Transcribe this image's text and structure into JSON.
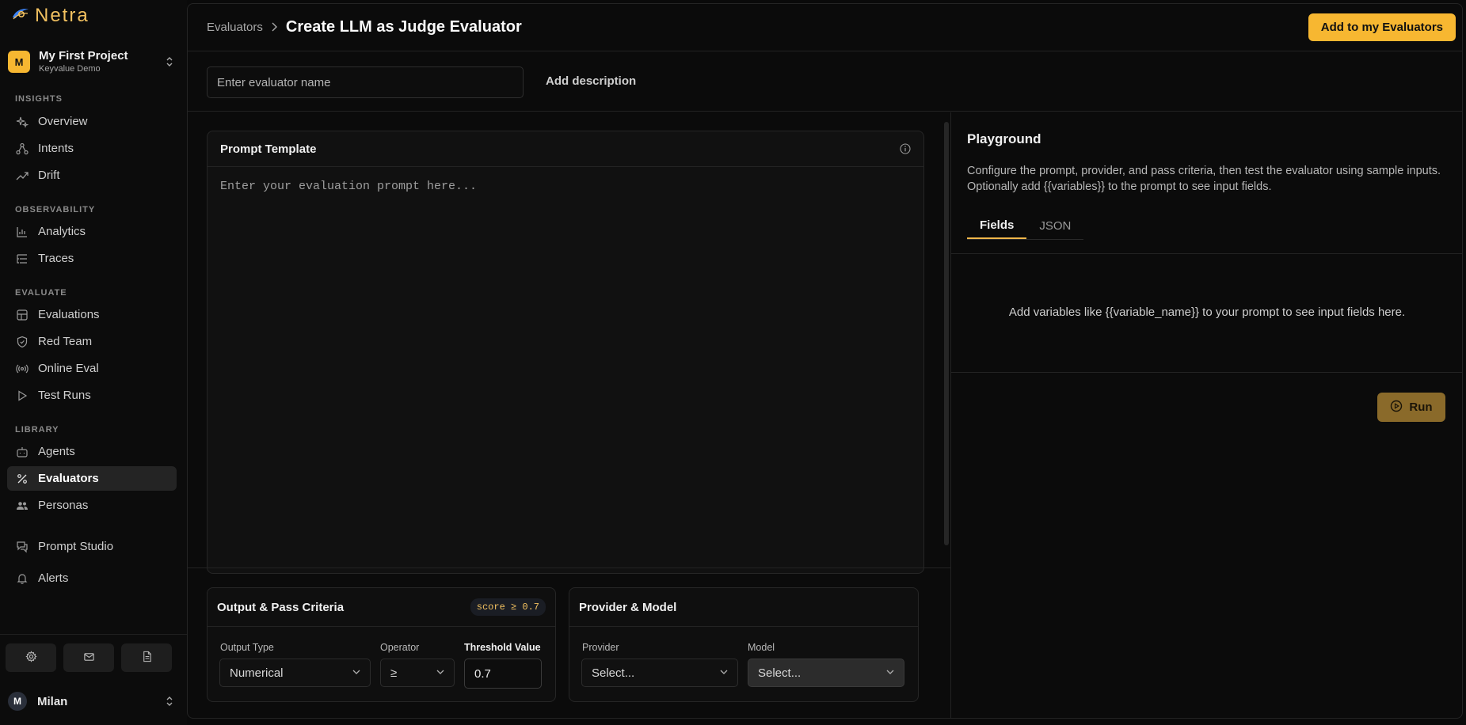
{
  "app": {
    "name": "Netra"
  },
  "project": {
    "initial": "M",
    "name": "My First Project",
    "subtitle": "Keyvalue Demo"
  },
  "sidebar": {
    "sections": {
      "insights": "INSIGHTS",
      "observability": "OBSERVABILITY",
      "evaluate": "EVALUATE",
      "library": "LIBRARY"
    },
    "items": {
      "overview": {
        "label": "Overview",
        "icon": "sparkles-icon"
      },
      "intents": {
        "label": "Intents",
        "icon": "nodes-icon"
      },
      "drift": {
        "label": "Drift",
        "icon": "trend-icon"
      },
      "analytics": {
        "label": "Analytics",
        "icon": "bar-chart-icon"
      },
      "traces": {
        "label": "Traces",
        "icon": "list-tree-icon"
      },
      "evaluations": {
        "label": "Evaluations",
        "icon": "grid-icon"
      },
      "red_team": {
        "label": "Red Team",
        "icon": "shield-icon"
      },
      "online_eval": {
        "label": "Online Eval",
        "icon": "broadcast-icon"
      },
      "test_runs": {
        "label": "Test Runs",
        "icon": "play-icon"
      },
      "agents": {
        "label": "Agents",
        "icon": "bot-icon"
      },
      "evaluators": {
        "label": "Evaluators",
        "icon": "percent-icon",
        "active": true
      },
      "personas": {
        "label": "Personas",
        "icon": "users-icon"
      },
      "prompt_studio": {
        "label": "Prompt Studio",
        "icon": "chat-icon"
      },
      "alerts": {
        "label": "Alerts",
        "icon": "bell-icon"
      }
    },
    "footer_buttons": [
      "gear-icon",
      "mail-icon",
      "document-icon"
    ],
    "user": {
      "initial": "M",
      "name": "Milan"
    }
  },
  "header": {
    "breadcrumb_parent": "Evaluators",
    "title": "Create LLM as Judge Evaluator",
    "primary_action": "Add to my Evaluators"
  },
  "form": {
    "name_placeholder": "Enter evaluator name",
    "add_description": "Add description"
  },
  "prompt": {
    "title": "Prompt Template",
    "placeholder": "Enter your evaluation prompt here..."
  },
  "criteria": {
    "title": "Output & Pass Criteria",
    "badge": "score ≥ 0.7",
    "output_type_label": "Output Type",
    "output_type_value": "Numerical",
    "operator_label": "Operator",
    "operator_value": "≥",
    "threshold_label": "Threshold Value",
    "threshold_value": "0.7"
  },
  "provider": {
    "title": "Provider & Model",
    "provider_label": "Provider",
    "provider_value": "Select...",
    "model_label": "Model",
    "model_value": "Select..."
  },
  "playground": {
    "title": "Playground",
    "description": "Configure the prompt, provider, and pass criteria, then test the evaluator using sample inputs. Optionally add {{variables}} to the prompt to see input fields.",
    "tabs": [
      "Fields",
      "JSON"
    ],
    "active_tab": "Fields",
    "empty_message": "Add variables like {{variable_name}} to your prompt to see input fields here.",
    "run_label": "Run"
  },
  "colors": {
    "accent": "#f7b731",
    "background": "#0a0a0a",
    "run_disabled": "#8a6a2a"
  }
}
